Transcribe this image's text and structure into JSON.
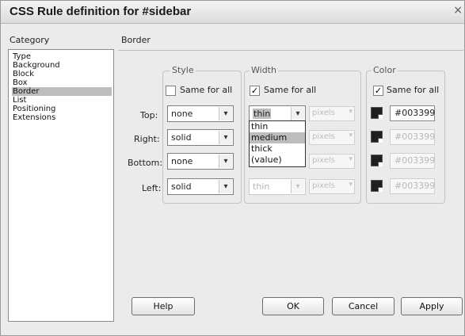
{
  "title": "CSS Rule definition for #sidebar",
  "close_glyph": "×",
  "category_heading": "Category",
  "categories": [
    "Type",
    "Background",
    "Block",
    "Box",
    "Border",
    "List",
    "Positioning",
    "Extensions"
  ],
  "selected_category": "Border",
  "section_heading": "Border",
  "groups": {
    "style": {
      "title": "Style",
      "same_for_all": "Same for all",
      "same_for_all_checked": false
    },
    "width": {
      "title": "Width",
      "same_for_all": "Same for all",
      "same_for_all_checked": true
    },
    "color": {
      "title": "Color",
      "same_for_all": "Same for all",
      "same_for_all_checked": true
    }
  },
  "check_glyph": "✓",
  "rows": [
    {
      "label": "Top:",
      "style": "none",
      "width": "thin",
      "unit": "pixels",
      "color": "#003399"
    },
    {
      "label": "Right:",
      "style": "solid",
      "width": "",
      "unit": "pixels",
      "color": "#003399"
    },
    {
      "label": "Bottom:",
      "style": "none",
      "width": "",
      "unit": "pixels",
      "color": "#003399"
    },
    {
      "label": "Left:",
      "style": "solid",
      "width": "thin",
      "unit": "pixels",
      "color": "#003399"
    }
  ],
  "width_dropdown_options": [
    "thin",
    "medium",
    "thick",
    "(value)"
  ],
  "width_dropdown_highlighted": "medium",
  "arrow_glyph": "▾",
  "buttons": {
    "help": "Help",
    "ok": "OK",
    "cancel": "Cancel",
    "apply": "Apply"
  },
  "colors": {
    "dialog_bg": "#ebebeb",
    "selection": "#bdbdbd",
    "swatch": "#1f1f1f"
  }
}
